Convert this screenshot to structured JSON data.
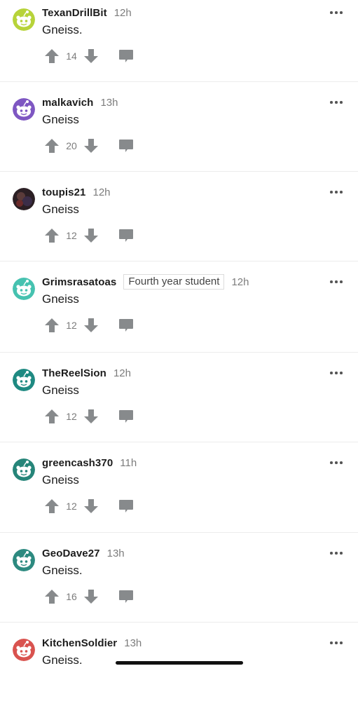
{
  "comments": [
    {
      "username": "TexanDrillBit",
      "time": "12h",
      "flair": "",
      "text": "Gneiss.",
      "score": "14",
      "avatar_color": "#b7d33a"
    },
    {
      "username": "malkavich",
      "time": "13h",
      "flair": "",
      "text": "Gneiss",
      "score": "20",
      "avatar_color": "#7e57c2"
    },
    {
      "username": "toupis21",
      "time": "12h",
      "flair": "",
      "text": "Gneiss",
      "score": "12",
      "avatar_color": "#2b1f24"
    },
    {
      "username": "Grimsrasatoas",
      "time": "12h",
      "flair": "Fourth year student",
      "text": "Gneiss",
      "score": "12",
      "avatar_color": "#46c2b0"
    },
    {
      "username": "TheReelSion",
      "time": "12h",
      "flair": "",
      "text": "Gneiss",
      "score": "12",
      "avatar_color": "#1f8a82"
    },
    {
      "username": "greencash370",
      "time": "11h",
      "flair": "",
      "text": "Gneiss",
      "score": "12",
      "avatar_color": "#268579"
    },
    {
      "username": "GeoDave27",
      "time": "13h",
      "flair": "",
      "text": "Gneiss.",
      "score": "16",
      "avatar_color": "#2d8a80"
    },
    {
      "username": "KitchenSoldier",
      "time": "13h",
      "flair": "",
      "text": "Gneiss.",
      "score": "",
      "avatar_color": "#d9534f"
    }
  ],
  "icons": {
    "upvote": "arrow-up-icon",
    "downvote": "arrow-down-icon",
    "reply": "comment-bubble-icon",
    "more": "more-dots-icon"
  },
  "colors": {
    "icon_gray": "#878a8c",
    "username": "#1c1c1c",
    "meta": "#7c7c7c",
    "divider": "#ececec"
  }
}
